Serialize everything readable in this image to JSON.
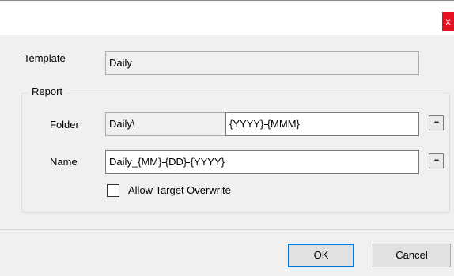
{
  "window": {
    "close_glyph": "x"
  },
  "template": {
    "label": "Template",
    "value": "Daily"
  },
  "report": {
    "group_label": "Report",
    "folder": {
      "label": "Folder",
      "base_value": "Daily\\",
      "pattern_value": "{YYYY}-{MMM}",
      "browse_label": "..."
    },
    "name": {
      "label": "Name",
      "value": "Daily_{MM}-{DD}-{YYYY}",
      "browse_label": "..."
    },
    "overwrite": {
      "label": "Allow Target Overwrite",
      "checked": false
    }
  },
  "buttons": {
    "ok": "OK",
    "cancel": "Cancel"
  },
  "colors": {
    "close_button": "#e81123",
    "default_button_border": "#0078d7",
    "dialog_background": "#f0f0f0"
  }
}
